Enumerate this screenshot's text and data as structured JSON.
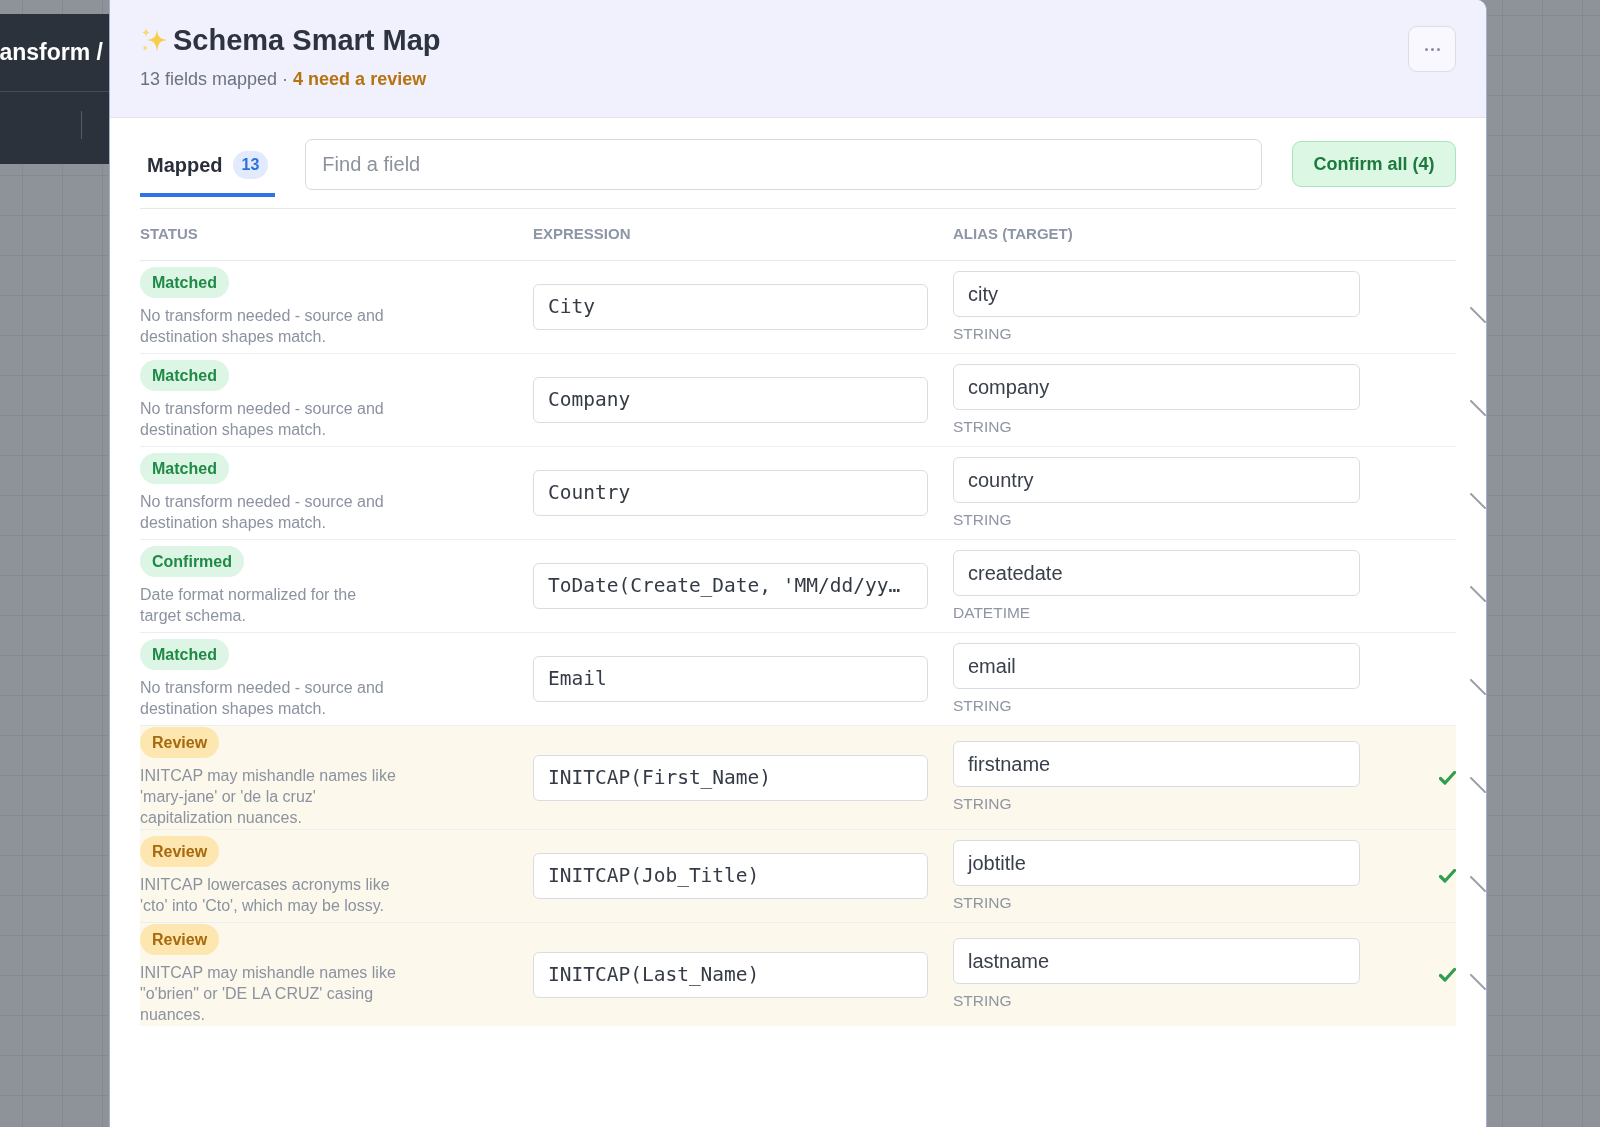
{
  "breadcrumb": {
    "text": "ansform /"
  },
  "dialog": {
    "title": "Schema Smart Map",
    "summary": "13 fields mapped · **4 need a review**",
    "tabs": [
      {
        "label": "Mapped",
        "count": "13",
        "selected": true
      }
    ],
    "search": {
      "placeholder": "Find a field"
    },
    "confirm_button": "Confirm all (4)",
    "table": {
      "columns": [
        "STATUS",
        "EXPRESSION",
        "ALIAS (TARGET)"
      ],
      "rows": [
        {
          "status": "Matched",
          "kind": "matched",
          "note": "No transform needed - source and destination shapes match.",
          "expression": "City",
          "alias": "city",
          "type": "STRING"
        },
        {
          "status": "Matched",
          "kind": "matched",
          "note": "No transform needed - source and destination shapes match.",
          "expression": "Company",
          "alias": "company",
          "type": "STRING"
        },
        {
          "status": "Matched",
          "kind": "matched",
          "note": "No transform needed - source and destination shapes match.",
          "expression": "Country",
          "alias": "country",
          "type": "STRING"
        },
        {
          "status": "Confirmed",
          "kind": "confirmed",
          "note": "Date format normalized for the target schema.",
          "expression": "ToDate(Create_Date, 'MM/dd/yy…",
          "alias": "createdate",
          "type": "DATETIME"
        },
        {
          "status": "Matched",
          "kind": "matched",
          "note": "No transform needed - source and destination shapes match.",
          "expression": "Email",
          "alias": "email",
          "type": "STRING"
        },
        {
          "status": "Review",
          "kind": "review",
          "note": "INITCAP may mishandle names like 'mary-jane' or 'de la cruz' capitalization nuances.",
          "expression": "INITCAP(First_Name)",
          "alias": "firstname",
          "type": "STRING"
        },
        {
          "status": "Review",
          "kind": "review",
          "note": "INITCAP lowercases acronyms like 'cto' into 'Cto', which may be lossy.",
          "expression": "INITCAP(Job_Title)",
          "alias": "jobtitle",
          "type": "STRING"
        },
        {
          "status": "Review",
          "kind": "review",
          "note": "INITCAP may mishandle names like \"o'brien\" or 'DE LA CRUZ' casing nuances.",
          "expression": "INITCAP(Last_Name)",
          "alias": "lastname",
          "type": "STRING"
        }
      ]
    }
  }
}
